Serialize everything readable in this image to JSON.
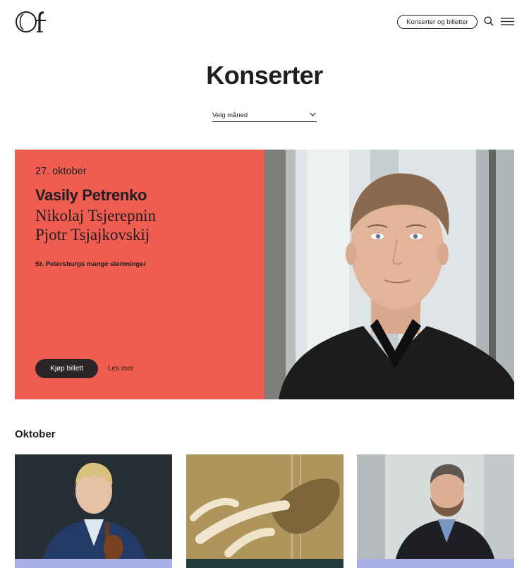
{
  "header": {
    "cta_label": "Konserter og billetter"
  },
  "page": {
    "title": "Konserter"
  },
  "filter": {
    "month_label": "Velg måned"
  },
  "featured": {
    "date": "27. oktober",
    "conductor": "Vasily Petrenko",
    "composers": [
      "Nikolaj Tsjerepnin",
      "Pjotr Tsjajkovskij"
    ],
    "subtitle": "St. Petersburgs mange stemninger",
    "buy_label": "Kjøp billett",
    "more_label": "Les mer",
    "panel_color": "#ee5d50"
  },
  "section": {
    "heading": "Oktober"
  },
  "cards": [
    {
      "strip_color": "#a9aee9"
    },
    {
      "strip_color": "#1f3b3a"
    },
    {
      "strip_color": "#a9aee9"
    }
  ],
  "colors": {
    "text": "#1f1d21",
    "button_dark": "#2a2529"
  },
  "icons": [
    "logo",
    "search-icon",
    "menu-icon",
    "chevron-down-icon"
  ]
}
